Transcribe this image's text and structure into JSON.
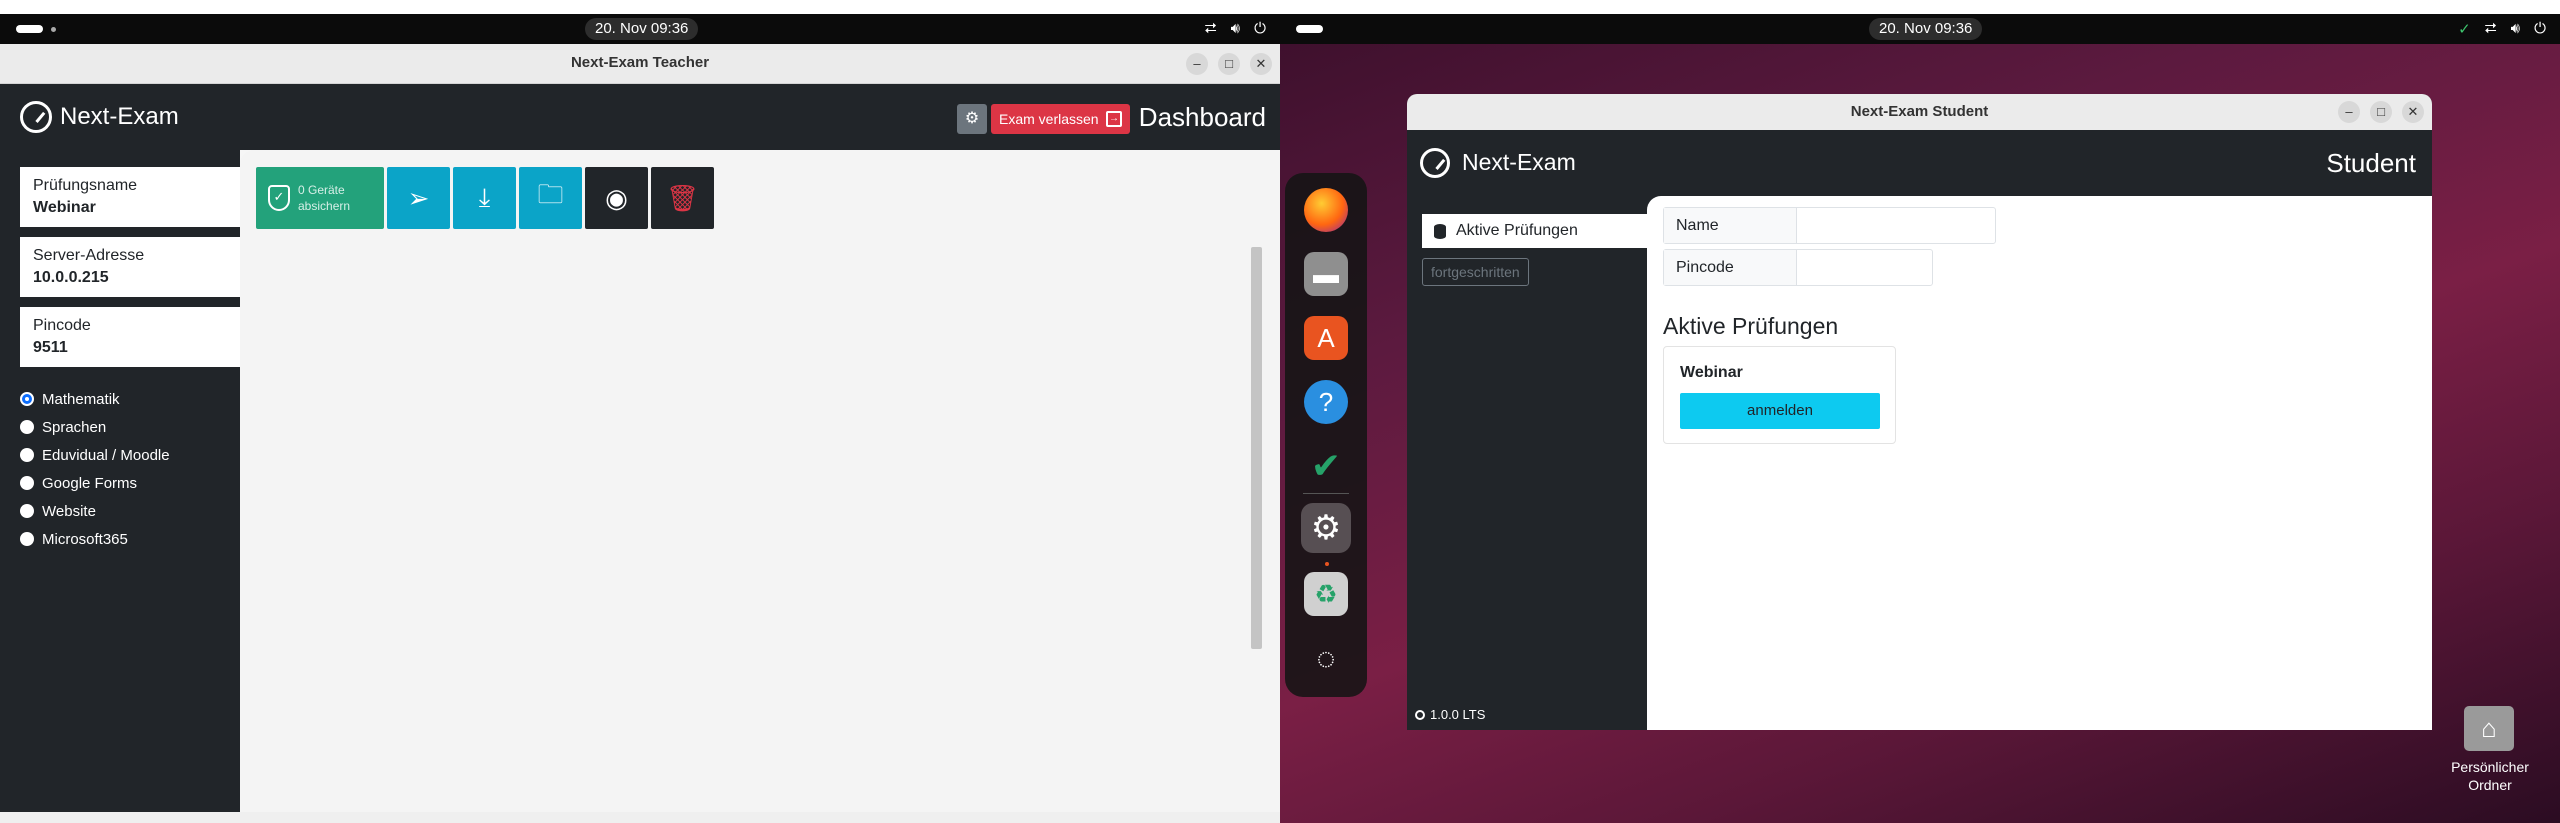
{
  "left_topbar": {
    "clock": "20. Nov  09:36"
  },
  "right_topbar": {
    "clock": "20. Nov  09:36"
  },
  "teacher": {
    "window_title": "Next-Exam Teacher",
    "logo_text": "Next-Exam",
    "leave_label": "Exam verlassen",
    "dashboard_label": "Dashboard",
    "exam_name_label": "Prüfungsname",
    "exam_name": "Webinar",
    "server_label": "Server-Adresse",
    "server_address": "10.0.0.215",
    "pincode_label": "Pincode",
    "pincode": "9511",
    "exam_modes": [
      {
        "label": "Mathematik",
        "checked": true
      },
      {
        "label": "Sprachen",
        "checked": false
      },
      {
        "label": "Eduvidual / Moodle",
        "checked": false
      },
      {
        "label": "Google Forms",
        "checked": false
      },
      {
        "label": "Website",
        "checked": false
      },
      {
        "label": "Microsoft365",
        "checked": false
      }
    ],
    "secure_label_line1": "0 Geräte",
    "secure_label_line2": "absichern"
  },
  "student": {
    "window_title": "Next-Exam Student",
    "logo_text": "Next-Exam",
    "role_label": "Student",
    "nav_active": "Aktive Prüfungen",
    "advanced_label": "fortgeschritten",
    "version": "1.0.0 LTS",
    "name_label": "Name",
    "name_value": "",
    "pincode_label": "Pincode",
    "pincode_value": "",
    "heading": "Aktive Prüfungen",
    "exam_card_name": "Webinar",
    "join_label": "anmelden"
  },
  "desktop": {
    "home_label_line1": "Persönlicher",
    "home_label_line2": "Ordner"
  },
  "colors": {
    "teacher_green": "#23a27b",
    "teacher_cyan": "#0ba4c8",
    "leave_red": "#dc3545",
    "join_cyan": "#0dcaf0",
    "app_dark": "#212529"
  }
}
